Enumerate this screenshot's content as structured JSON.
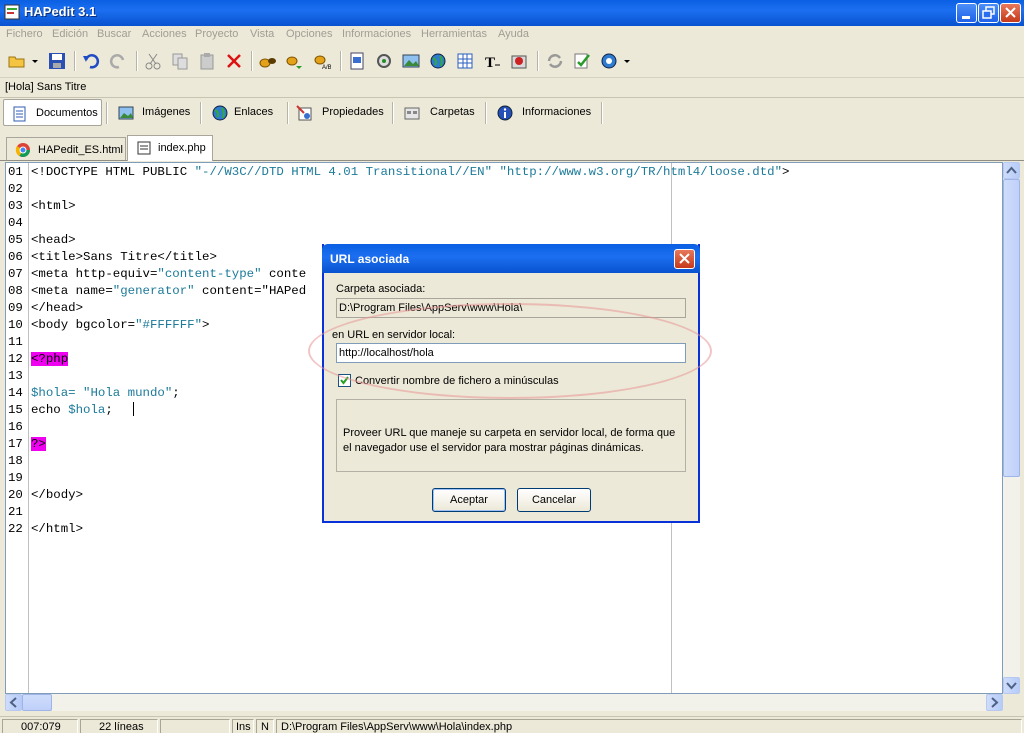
{
  "window": {
    "title": "HAPedit 3.1"
  },
  "menu": [
    "Fichero",
    "Edición",
    "Buscar",
    "Acciones",
    "Proyecto",
    "Vista",
    "Opciones",
    "Informaciones",
    "Herramientas",
    "Ayuda"
  ],
  "doc_path": "[Hola] Sans Titre",
  "panel_tabs": [
    "Documentos",
    "Imágenes",
    "Enlaces",
    "Propiedades",
    "Carpetas",
    "Informaciones"
  ],
  "file_tabs": [
    "HAPedit_ES.html",
    "index.php"
  ],
  "code_lines": [
    {
      "n": "01",
      "t": "<!DOCTYPE HTML PUBLIC ",
      "s": "\"-//W3C//DTD HTML 4.01 Transitional//EN\" \"http://www.w3.org/TR/html4/loose.dtd\"",
      "e": ">"
    },
    {
      "n": "02",
      "t": "",
      "s": "",
      "e": ""
    },
    {
      "n": "03",
      "t": "<html>",
      "s": "",
      "e": ""
    },
    {
      "n": "04",
      "t": "",
      "s": "",
      "e": ""
    },
    {
      "n": "05",
      "t": "<head>",
      "s": "",
      "e": ""
    },
    {
      "n": "06",
      "t": "<title>Sans Titre</title>",
      "s": "",
      "e": ""
    },
    {
      "n": "07",
      "t": "<meta http-equiv=",
      "s": "\"content-type\"",
      "e": " conte"
    },
    {
      "n": "08",
      "t": "<meta name=",
      "s": "\"generator\"",
      "e": " content=\"HAPed"
    },
    {
      "n": "09",
      "t": "</head>",
      "s": "",
      "e": ""
    },
    {
      "n": "10",
      "t": "<body bgcolor=",
      "s": "\"#FFFFFF\"",
      "e": ">"
    },
    {
      "n": "11",
      "t": "",
      "s": "",
      "e": ""
    },
    {
      "n": "12",
      "t": "",
      "s": "",
      "e": "",
      "php": "<?php"
    },
    {
      "n": "13",
      "t": "",
      "s": "",
      "e": ""
    },
    {
      "n": "14",
      "t": "",
      "s": "$hola= \"Hola mundo\"",
      "e": ";"
    },
    {
      "n": "15",
      "t": "echo ",
      "s": "$hola",
      "e": ";"
    },
    {
      "n": "16",
      "t": "",
      "s": "",
      "e": ""
    },
    {
      "n": "17",
      "t": "",
      "s": "",
      "e": "",
      "php": "?>"
    },
    {
      "n": "18",
      "t": "",
      "s": "",
      "e": ""
    },
    {
      "n": "19",
      "t": "",
      "s": "",
      "e": ""
    },
    {
      "n": "20",
      "t": "</body>",
      "s": "",
      "e": ""
    },
    {
      "n": "21",
      "t": "",
      "s": "",
      "e": ""
    },
    {
      "n": "22",
      "t": "</html>",
      "s": "",
      "e": ""
    }
  ],
  "status": {
    "position": "007:079",
    "lines": "22 líneas",
    "ins": "Ins",
    "n": "N",
    "path": "D:\\Program Files\\AppServ\\www\\Hola\\index.php"
  },
  "dialog": {
    "title": "URL asociada",
    "folder_label": "Carpeta asociada:",
    "folder_value": "D:\\Program Files\\AppServ\\www\\Hola\\",
    "url_label": "en URL en servidor local:",
    "url_value": "http://localhost/hola",
    "checkbox_label": "Convertir nombre de fichero a minúsculas",
    "checkbox_checked": true,
    "description": "Proveer URL que maneje su carpeta en servidor local, de forma que el navegador use el servidor para mostrar páginas dinámicas.",
    "ok": "Aceptar",
    "cancel": "Cancelar"
  }
}
